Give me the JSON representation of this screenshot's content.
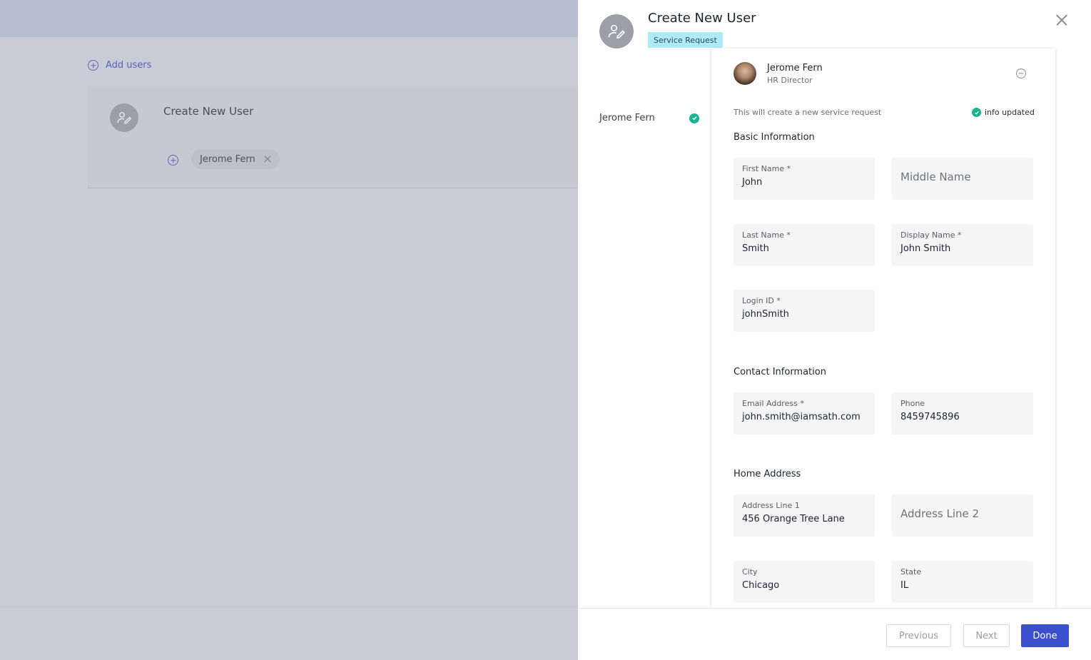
{
  "background": {
    "add_users_label": "Add users",
    "card": {
      "title": "Create New User",
      "chip_label": "Jerome Fern"
    }
  },
  "panel": {
    "title": "Create New User",
    "badge": "Service Request",
    "left_nav": {
      "label": "Jerome Fern"
    },
    "user": {
      "name": "Jerome Fern",
      "role": "HR Director"
    },
    "request_note": "This will create a new service request",
    "info_updated": "info updated",
    "sections": {
      "basic": "Basic Information",
      "contact": "Contact Information",
      "home": "Home Address"
    },
    "fields": {
      "first_name": {
        "label": "First Name *",
        "value": "John"
      },
      "middle_name": {
        "placeholder": "Middle Name"
      },
      "last_name": {
        "label": "Last Name *",
        "value": "Smith"
      },
      "display_name": {
        "label": "Display Name *",
        "value": "John Smith"
      },
      "login_id": {
        "label": "Login ID *",
        "value": "johnSmith"
      },
      "email": {
        "label": "Email Address *",
        "value": "john.smith@iamsath.com"
      },
      "phone": {
        "label": "Phone",
        "value": "8459745896"
      },
      "address1": {
        "label": "Address Line 1",
        "value": "456 Orange Tree Lane"
      },
      "address2": {
        "placeholder": "Address Line 2"
      },
      "city": {
        "label": "City",
        "value": "Chicago"
      },
      "state": {
        "label": "State",
        "value": "IL"
      }
    },
    "buttons": {
      "previous": "Previous",
      "next": "Next",
      "done": "Done"
    }
  },
  "colors": {
    "accent": "#3b4fcf",
    "success": "#19b394",
    "badge_bg": "#aeeaf8"
  },
  "icons": [
    "add-circle-icon",
    "user-edit-icon",
    "close-icon",
    "check-circle-icon",
    "remove-circle-icon"
  ]
}
